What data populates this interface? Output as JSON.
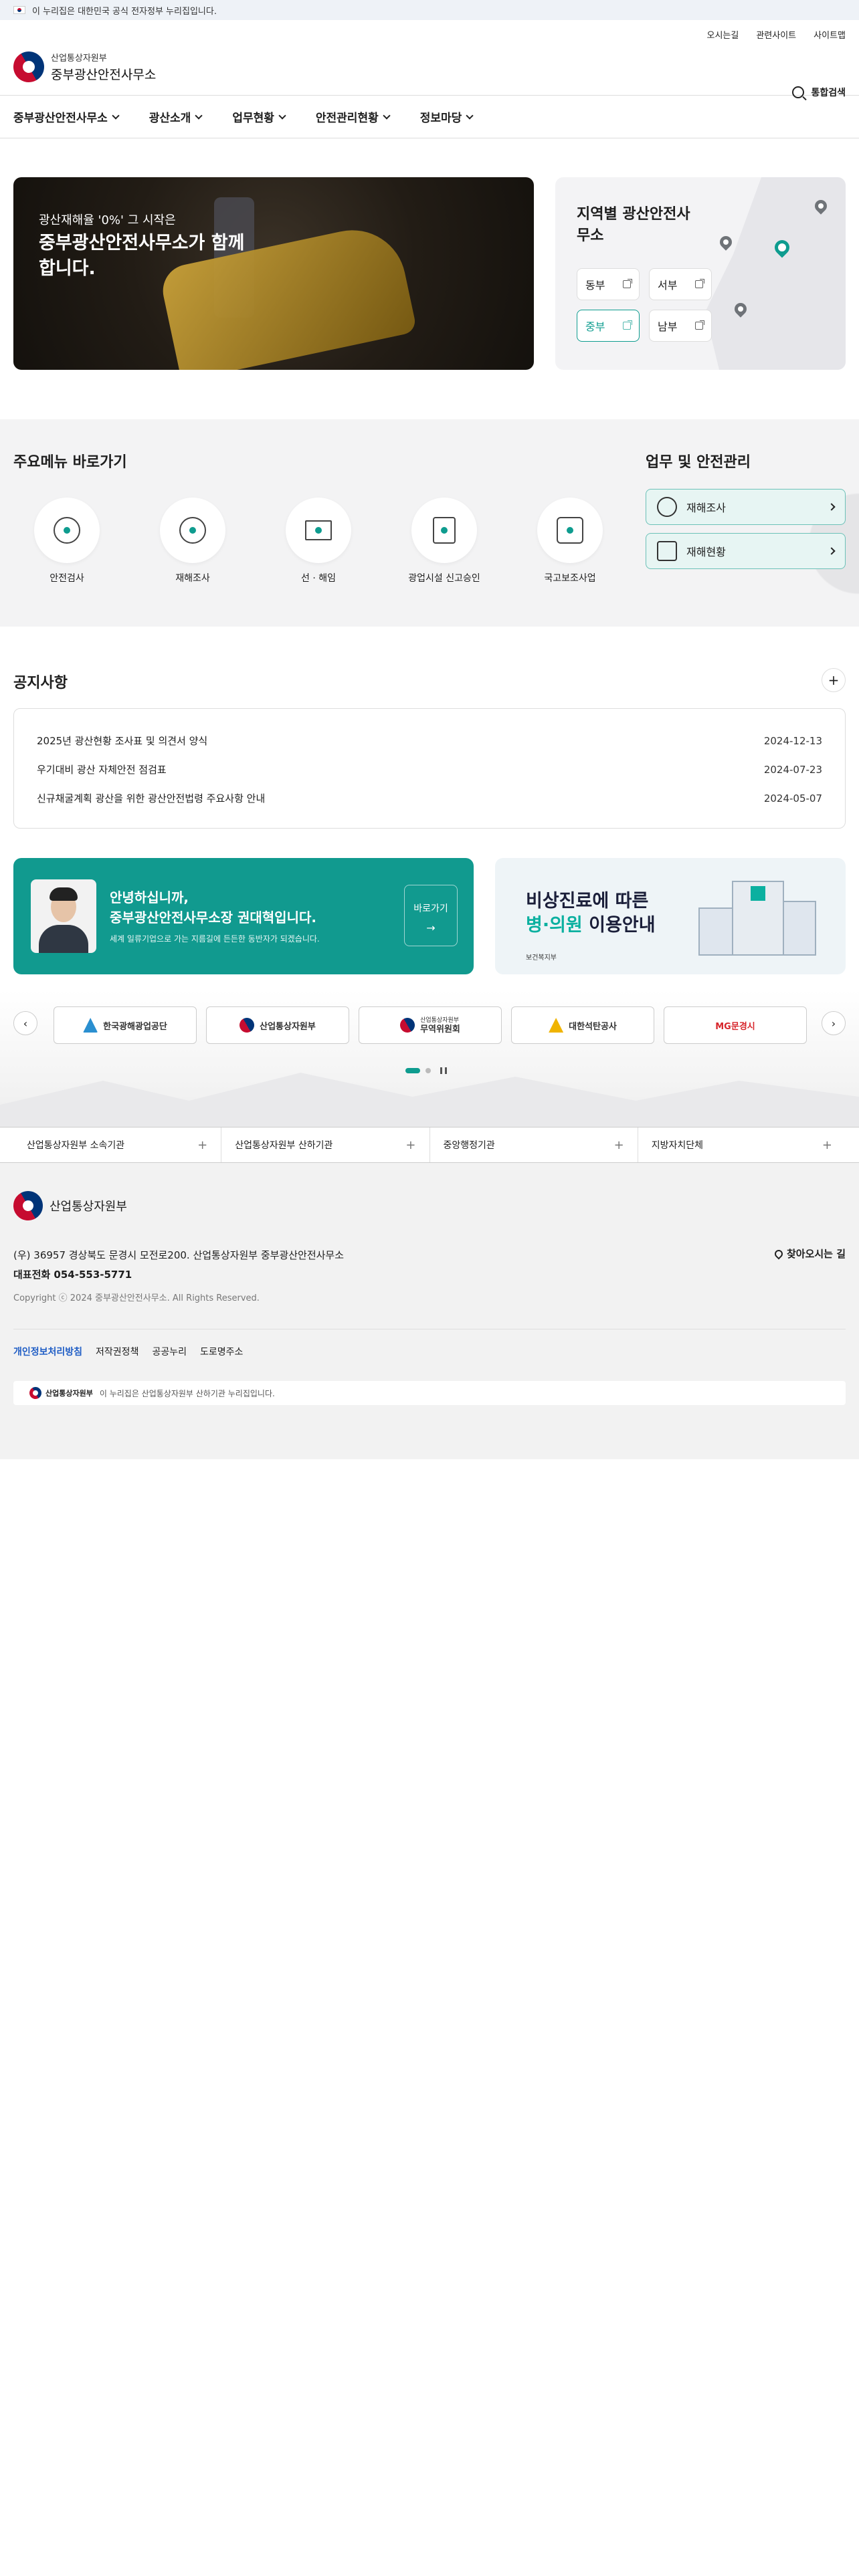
{
  "gov_banner": "이 누리집은 대한민국 공식 전자정부 누리집입니다.",
  "header": {
    "utils": [
      "오시는길",
      "관련사이트",
      "사이트맵"
    ],
    "logo_small": "산업통상자원부",
    "logo_big": "중부광산안전사무소",
    "search_label": "통합검색"
  },
  "nav": [
    "중부광산안전사무소",
    "광산소개",
    "업무현황",
    "안전관리현황",
    "정보마당"
  ],
  "hero": {
    "sub": "광산재해율 '0%' 그 시작은",
    "main": "중부광산안전사무소가 함께합니다."
  },
  "region": {
    "title": "지역별 광산안전사무소",
    "buttons": [
      "동부",
      "서부",
      "중부",
      "남부"
    ],
    "active": "중부"
  },
  "quick": {
    "title": "주요메뉴 바로가기",
    "items": [
      "안전검사",
      "재해조사",
      "선 · 해임",
      "광업시설 신고승인",
      "국고보조사업"
    ]
  },
  "safety": {
    "title": "업무 및 안전관리",
    "buttons": [
      "재해조사",
      "재해현황"
    ]
  },
  "notice": {
    "title": "공지사항",
    "more": "+",
    "rows": [
      {
        "title": "2025년 광산현황 조사표 및 의견서 양식",
        "date": "2024-12-13"
      },
      {
        "title": "우기대비 광산 자체안전 점검표",
        "date": "2024-07-23"
      },
      {
        "title": "신규채굴계획 광산을 위한 광산안전법령 주요사항 안내",
        "date": "2024-05-07"
      }
    ]
  },
  "greeting": {
    "line1": "안녕하십니까,",
    "line2": "중부광산안전사무소장 권대혁입니다.",
    "desc": "세계 일류기업으로 가는 지름길에 든든한 동반자가 되겠습니다.",
    "go": "바로가기",
    "go_arrow": "→"
  },
  "er_banner": {
    "line1": "비상진료에 따른",
    "accent": "병·의원",
    "line2_rest": " 이용안내",
    "org": "보건복지부"
  },
  "related": {
    "prev": "‹",
    "next": "›",
    "logos": [
      {
        "name": "한국광해광업공단",
        "color": "#2a8fd0"
      },
      {
        "name": "산업통상자원부",
        "color": "#003478"
      },
      {
        "name": "무역위원회",
        "color": "#003478"
      },
      {
        "name": "대한석탄공사",
        "color": "#f0b400"
      },
      {
        "name": "MG문경시",
        "color": "#d7252b"
      }
    ],
    "logo3_small": "산업통상자원부"
  },
  "groups": [
    "산업통상자원부 소속기관",
    "산업통상자원부 산하기관",
    "중앙행정기관",
    "지방자치단체"
  ],
  "footer": {
    "logo": "산업통상자원부",
    "address": "(우) 36957 경상북도 문경시 모전로200. 산업통상자원부 중부광산안전사무소",
    "tel": "대표전화 054-553-5771",
    "copyright": "Copyright ⓒ 2024 중부광산안전사무소. All Rights Reserved.",
    "directions": "찾아오시는 길",
    "links": [
      "개인정보처리방침",
      "저작권정책",
      "공공누리",
      "도로명주소"
    ],
    "nuri_logo": "산업통상자원부",
    "nuri_text": "이 누리집은 산업통상자원부 산하기관 누리집입니다."
  },
  "colors": {
    "accent": "#0e9c8f",
    "link": "#1f5dc5"
  }
}
